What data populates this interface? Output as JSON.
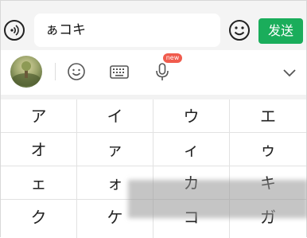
{
  "input": {
    "text": "ぁコキ",
    "send_label": "发送"
  },
  "toolbar": {
    "new_badge": "new",
    "icons": [
      "avatar",
      "smiley-icon",
      "keyboard-icon",
      "microphone-icon",
      "chevron-down-icon"
    ]
  },
  "keyboard": {
    "rows": [
      [
        "ア",
        "イ",
        "ウ",
        "エ"
      ],
      [
        "オ",
        "ァ",
        "ィ",
        "ゥ"
      ],
      [
        "ェ",
        "ォ",
        "カ",
        "キ"
      ],
      [
        "ク",
        "ケ",
        "コ",
        "ガ"
      ]
    ]
  },
  "colors": {
    "send_button": "#1aad5b",
    "badge": "#f05b4d"
  }
}
